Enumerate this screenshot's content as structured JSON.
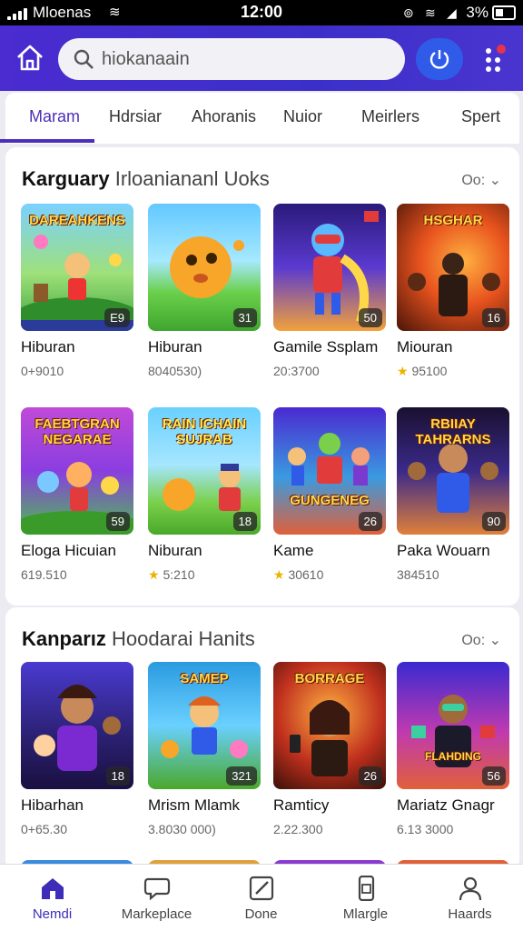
{
  "status_bar": {
    "carrier": "Mloenas",
    "time": "12:00",
    "battery": "3%"
  },
  "header": {
    "search": {
      "value": "hiokanaain",
      "placeholder": "hiokanaain"
    }
  },
  "tabs": [
    {
      "label": "Maram",
      "active": true
    },
    {
      "label": "Hdrsiar"
    },
    {
      "label": "Ahoranis"
    },
    {
      "label": "Nuior"
    },
    {
      "label": "Meirlers"
    },
    {
      "label": "Spert"
    }
  ],
  "sections": [
    {
      "title_bold": "Karguary",
      "title_rest": "Irloaniananl Uoks",
      "more": "Oo:",
      "cards": [
        {
          "caption": "DAREAHKENS",
          "badge": "E9",
          "title": "Hiburan",
          "sub": "0+9010",
          "star": false
        },
        {
          "caption": "",
          "badge": "31",
          "title": "Hiburan",
          "sub": "8040530)",
          "star": false
        },
        {
          "caption": "",
          "badge": "50",
          "title": "Gamile Ssplam",
          "sub": "20:3700",
          "star": false
        },
        {
          "caption": "HSGHAR",
          "badge": "16",
          "title": "Miouran",
          "sub": "95100",
          "star": true
        },
        {
          "caption": "FAEBTGRAN NEGARAE",
          "badge": "59",
          "title": "Eloga Hicuian",
          "sub": "619.510",
          "star": false
        },
        {
          "caption": "RAIN ICHAIN SUJRAB",
          "badge": "18",
          "title": "Niburan",
          "sub": "5:210",
          "star": true
        },
        {
          "caption": "GUNGENEG",
          "badge": "26",
          "title": "Kame",
          "sub": "30610",
          "star": true
        },
        {
          "caption": "RBIIAY TAHRARNS",
          "badge": "90",
          "title": "Paka Wouarn",
          "sub": "384510",
          "star": false
        }
      ]
    },
    {
      "title_bold": "Kanparız",
      "title_rest": "Hoodarai Hanits",
      "more": "Oo:",
      "cards": [
        {
          "caption": "",
          "badge": "18",
          "title": "Hibarhan",
          "sub": "0+65.30",
          "star": false
        },
        {
          "caption": "SAMEP",
          "badge": "321",
          "title": "Mrism Mlamk",
          "sub": "3.8030 000)",
          "star": false
        },
        {
          "caption": "BORRAGE",
          "badge": "26",
          "title": "Ramticy",
          "sub": "2.22.300",
          "star": false
        },
        {
          "caption": "FLAHDING",
          "badge": "56",
          "title": "Mariatz Gnagr",
          "sub": "6.13 3000",
          "star": false
        }
      ]
    }
  ],
  "bottom_nav": [
    {
      "label": "Nemdi",
      "icon": "home-icon",
      "active": true
    },
    {
      "label": "Markeplace",
      "icon": "chat-bubble-icon"
    },
    {
      "label": "Done",
      "icon": "edit-square-icon"
    },
    {
      "label": "Mlargle",
      "icon": "phone-icon"
    },
    {
      "label": "Haards",
      "icon": "profile-icon"
    }
  ],
  "colors": {
    "header": "#4a2cd0",
    "accent": "#4b2fb8",
    "power_button": "#2f5be8"
  }
}
